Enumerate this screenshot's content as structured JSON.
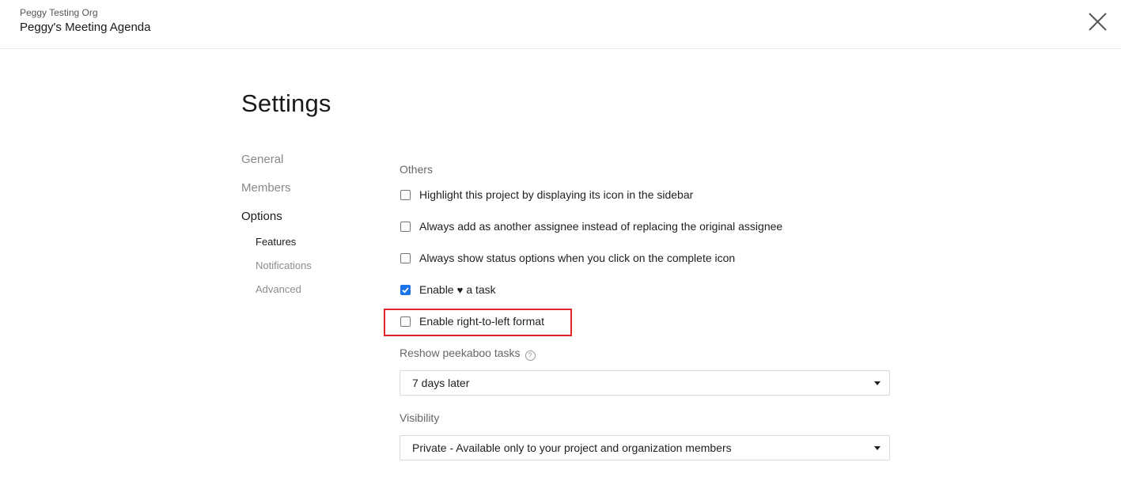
{
  "header": {
    "org_name": "Peggy Testing Org",
    "project_name": "Peggy's Meeting Agenda"
  },
  "page": {
    "title": "Settings"
  },
  "nav": {
    "items": [
      {
        "label": "General"
      },
      {
        "label": "Members"
      },
      {
        "label": "Options"
      }
    ],
    "sub_items": [
      {
        "label": "Features"
      },
      {
        "label": "Notifications"
      },
      {
        "label": "Advanced"
      }
    ]
  },
  "others": {
    "section_label": "Others",
    "options": [
      {
        "label": "Highlight this project by displaying its icon in the sidebar",
        "checked": false
      },
      {
        "label": "Always add as another assignee instead of replacing the original assignee",
        "checked": false
      },
      {
        "label": "Always show status options when you click on the complete icon",
        "checked": false
      },
      {
        "label_before": "Enable",
        "label_after": "a task",
        "icon": "heart-icon",
        "checked": true
      },
      {
        "label": "Enable right-to-left format",
        "checked": false
      }
    ]
  },
  "reshow": {
    "label": "Reshow peekaboo tasks",
    "help_glyph": "?",
    "value": "7 days later"
  },
  "visibility": {
    "label": "Visibility",
    "value": "Private - Available only to your project and organization members"
  },
  "colors": {
    "accent": "#1a73e8",
    "highlight_border": "#e0262b"
  }
}
